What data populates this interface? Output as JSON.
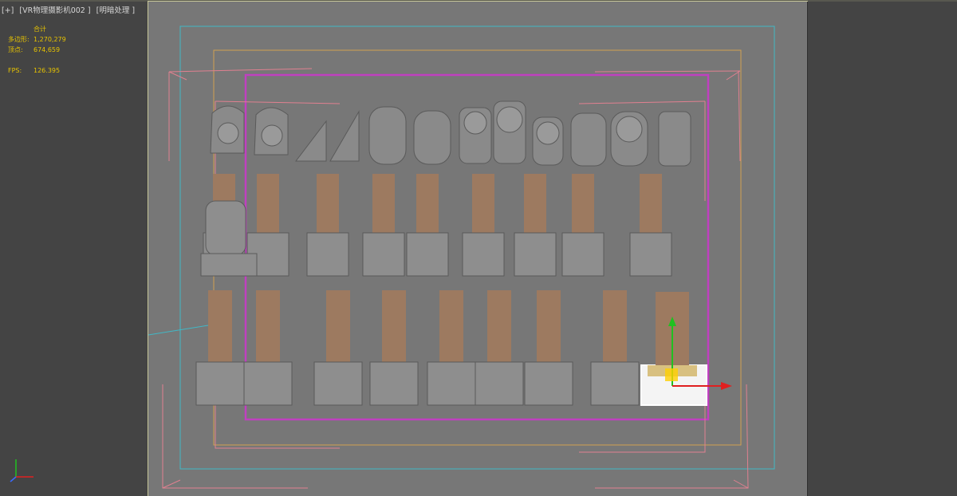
{
  "viewport": {
    "menu_plus": "[+]",
    "camera": "[VR物理摄影机002 ]",
    "shading": "[明暗处理 ]"
  },
  "stats": {
    "total_label": "合计",
    "poly_label": "多边形:",
    "poly_value": "1,270,279",
    "vert_label": "顶点:",
    "vert_value": "674,659",
    "fps_label": "FPS:",
    "fps_value": "126.395"
  },
  "colors": {
    "viewport_bg": "#777777",
    "column_wood": "#9d7a60",
    "stone": "#8e8e8e",
    "safe_frame_cyan": "#41b8c6",
    "safe_frame_orange": "#d0a050",
    "safe_frame_magenta": "#c040c0",
    "selection": "#ffffff",
    "gizmo_x": "#e02020",
    "gizmo_y": "#20c020",
    "gizmo_z": "#ffd000"
  },
  "icons": {
    "axis_tripod": "xyz-axis-icon",
    "gizmo": "move-gizmo-icon"
  }
}
